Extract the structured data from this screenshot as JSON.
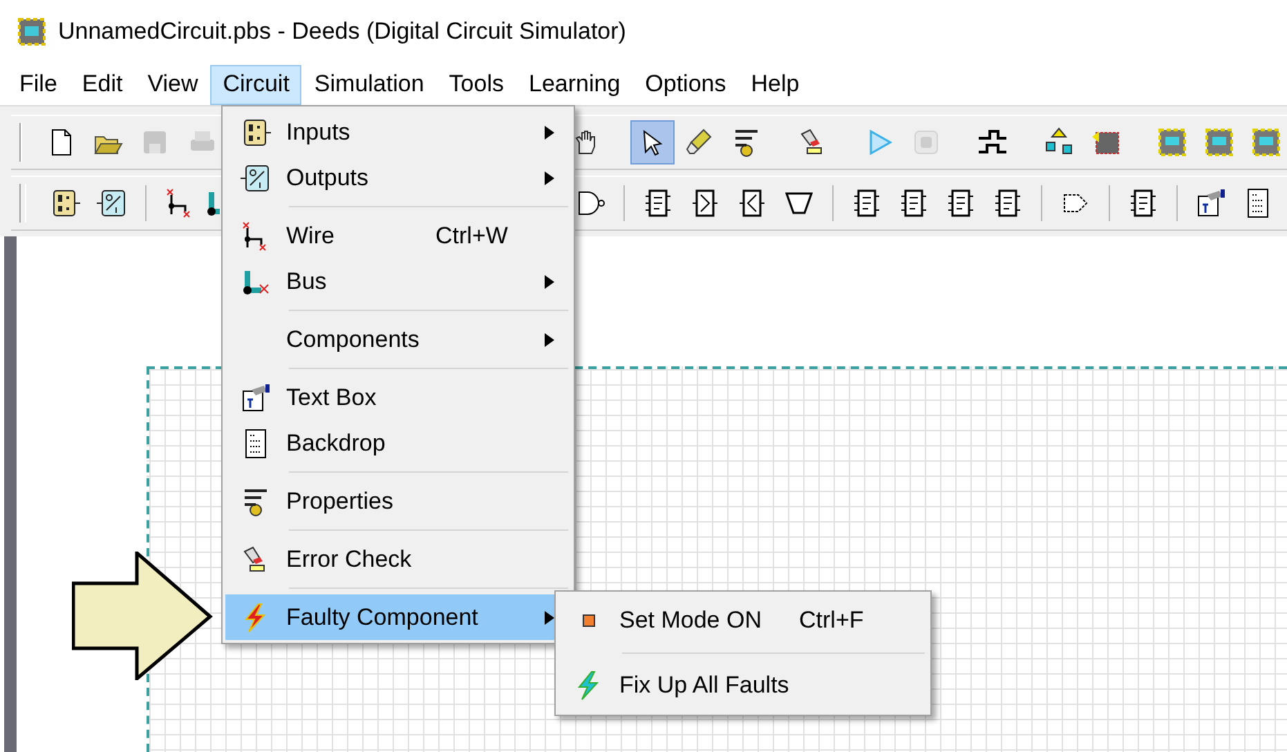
{
  "window": {
    "title": "UnnamedCircuit.pbs - Deeds (Digital Circuit Simulator)"
  },
  "menu_bar": [
    {
      "label": "File",
      "selected": false
    },
    {
      "label": "Edit",
      "selected": false
    },
    {
      "label": "View",
      "selected": false
    },
    {
      "label": "Circuit",
      "selected": true
    },
    {
      "label": "Simulation",
      "selected": false
    },
    {
      "label": "Tools",
      "selected": false
    },
    {
      "label": "Learning",
      "selected": false
    },
    {
      "label": "Options",
      "selected": false
    },
    {
      "label": "Help",
      "selected": false
    }
  ],
  "toolbars": [
    {
      "groups": [
        [
          {
            "kind": "new",
            "disabled": false,
            "selected": false
          },
          {
            "kind": "open",
            "disabled": false,
            "selected": false
          },
          {
            "kind": "save",
            "disabled": true,
            "selected": false
          },
          {
            "kind": "print",
            "disabled": true,
            "selected": false
          }
        ],
        [
          {
            "kind": "hand",
            "disabled": false,
            "selected": false
          }
        ],
        [
          {
            "kind": "pointer",
            "disabled": false,
            "selected": true
          },
          {
            "kind": "eraser",
            "disabled": false,
            "selected": false
          },
          {
            "kind": "props",
            "disabled": false,
            "selected": false
          }
        ],
        [
          {
            "kind": "errorcheck",
            "disabled": false,
            "selected": false
          }
        ],
        [
          {
            "kind": "play",
            "disabled": false,
            "selected": false
          },
          {
            "kind": "stop",
            "disabled": true,
            "selected": false
          }
        ],
        [
          {
            "kind": "wave",
            "disabled": false,
            "selected": false
          }
        ],
        [
          {
            "kind": "chipup",
            "disabled": false,
            "selected": false
          },
          {
            "kind": "chipfn",
            "disabled": false,
            "selected": false
          }
        ],
        [
          {
            "kind": "chip",
            "disabled": false,
            "selected": false
          },
          {
            "kind": "chip",
            "disabled": false,
            "selected": false
          },
          {
            "kind": "chip",
            "disabled": false,
            "selected": false
          }
        ]
      ]
    },
    {
      "groups": [
        [
          {
            "kind": "inputs",
            "disabled": false,
            "selected": false
          },
          {
            "kind": "outputs",
            "disabled": false,
            "selected": false
          }
        ],
        [
          {
            "kind": "wire",
            "disabled": false,
            "selected": false
          },
          {
            "kind": "bus",
            "disabled": false,
            "selected": false
          }
        ],
        [
          {
            "kind": "nand",
            "disabled": false,
            "selected": false
          }
        ],
        [
          {
            "kind": "ic",
            "disabled": false,
            "selected": false
          },
          {
            "kind": "buffer",
            "disabled": false,
            "selected": false
          },
          {
            "kind": "bufferrev",
            "disabled": false,
            "selected": false
          },
          {
            "kind": "mux",
            "disabled": false,
            "selected": false
          }
        ],
        [
          {
            "kind": "ic",
            "disabled": false,
            "selected": false
          },
          {
            "kind": "ic",
            "disabled": false,
            "selected": false
          },
          {
            "kind": "ic",
            "disabled": false,
            "selected": false
          },
          {
            "kind": "ic",
            "disabled": false,
            "selected": false
          }
        ],
        [
          {
            "kind": "tri",
            "disabled": false,
            "selected": false
          }
        ],
        [
          {
            "kind": "ic",
            "disabled": false,
            "selected": false
          }
        ],
        [
          {
            "kind": "textbox",
            "disabled": false,
            "selected": false
          },
          {
            "kind": "backdrop",
            "disabled": false,
            "selected": false
          }
        ]
      ]
    }
  ],
  "circuit_menu": [
    {
      "kind": "item",
      "label": "Inputs",
      "submenu": true,
      "highlighted": false
    },
    {
      "kind": "item",
      "label": "Outputs",
      "submenu": true,
      "highlighted": false
    },
    {
      "kind": "separator"
    },
    {
      "kind": "item",
      "label": "Wire",
      "shortcut": "Ctrl+W",
      "submenu": false,
      "highlighted": false
    },
    {
      "kind": "item",
      "label": "Bus",
      "submenu": true,
      "highlighted": false
    },
    {
      "kind": "separator"
    },
    {
      "kind": "item",
      "label": "Components",
      "submenu": true,
      "highlighted": false
    },
    {
      "kind": "separator"
    },
    {
      "kind": "item",
      "label": "Text Box",
      "submenu": false,
      "highlighted": false
    },
    {
      "kind": "item",
      "label": "Backdrop",
      "submenu": false,
      "highlighted": false
    },
    {
      "kind": "separator"
    },
    {
      "kind": "item",
      "label": "Properties",
      "submenu": false,
      "highlighted": false
    },
    {
      "kind": "separator"
    },
    {
      "kind": "item",
      "label": "Error Check",
      "submenu": false,
      "highlighted": false
    },
    {
      "kind": "separator"
    },
    {
      "kind": "item",
      "label": "Faulty Component",
      "submenu": true,
      "highlighted": true
    }
  ],
  "faulty_submenu": [
    {
      "kind": "item",
      "label": "Set Mode ON",
      "shortcut": "Ctrl+F",
      "submenu": false,
      "highlighted": false
    },
    {
      "kind": "separator"
    },
    {
      "kind": "item",
      "label": "Fix Up All Faults",
      "submenu": false,
      "highlighted": false
    }
  ]
}
